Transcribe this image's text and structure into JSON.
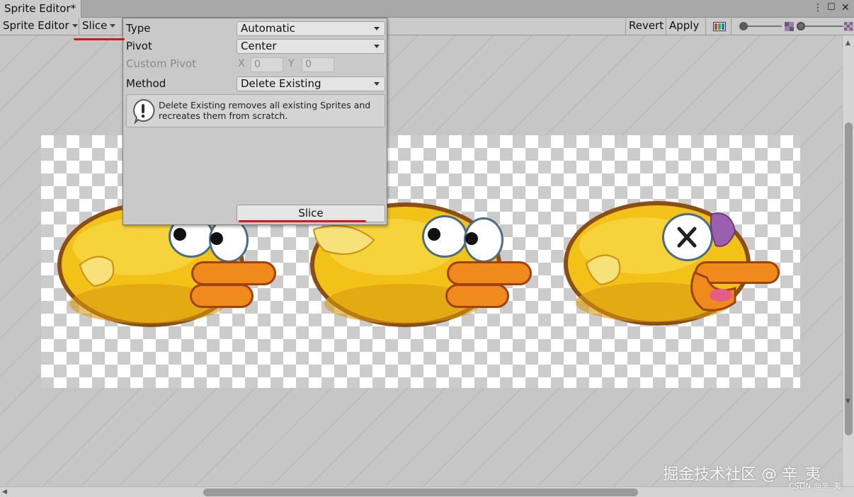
{
  "window": {
    "tab_title": "Sprite Editor*",
    "more_icon": "more-vertical-icon",
    "maximize_icon": "maximize-icon",
    "close_icon": "close-icon"
  },
  "toolbar": {
    "mode_dropdown": "Sprite Editor",
    "slice_menu": "Slice",
    "revert": "Revert",
    "apply": "Apply",
    "channel_icon": "color-channels-icon",
    "zoom_icon_small": "texture-small-icon",
    "mip_icon": "texture-mip-icon"
  },
  "slice_popup": {
    "type_label": "Type",
    "type_value": "Automatic",
    "pivot_label": "Pivot",
    "pivot_value": "Center",
    "custom_pivot_label": "Custom Pivot",
    "x_label": "X",
    "x_value": "0",
    "y_label": "Y",
    "y_value": "0",
    "method_label": "Method",
    "method_value": "Delete Existing",
    "help_text": "Delete Existing removes all existing Sprites and recreates them from scratch.",
    "help_icon": "warning-info-icon",
    "slice_button": "Slice"
  },
  "canvas": {
    "sprites": [
      "bird-frame-1",
      "bird-frame-2",
      "bird-frame-3-dazed"
    ]
  },
  "watermark": {
    "line1": "掘金技术社区 @ 辛_夷",
    "line2": "CSDN @辛_夷"
  },
  "colors": {
    "annotation_red": "#d9141c",
    "bird_yellow": "#f2c219",
    "beak_orange": "#f08a1c"
  }
}
